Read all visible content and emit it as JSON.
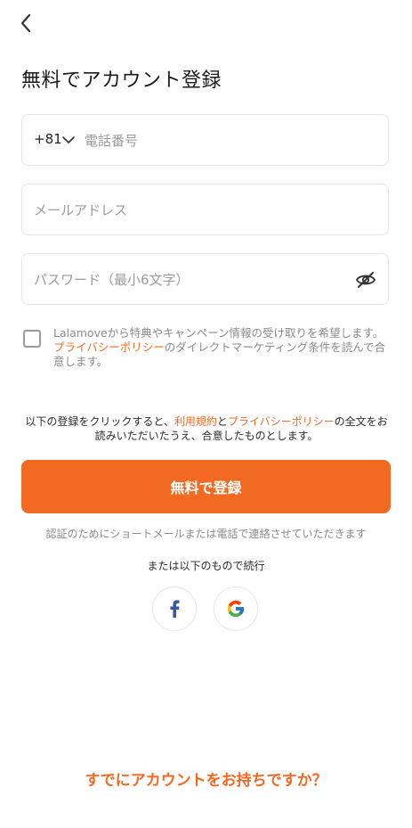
{
  "header": {
    "title": "無料でアカウント登録"
  },
  "form": {
    "phone": {
      "country_code": "+81",
      "placeholder": "電話番号"
    },
    "email": {
      "placeholder": "メールアドレス"
    },
    "password": {
      "placeholder": "パスワード（最小6文字）"
    }
  },
  "consent": {
    "text_1": "Lalamoveから特典やキャンペーン情報の受け取りを希望します。",
    "privacy_link": "プライバシーポリシー",
    "text_2": "のダイレクトマーケティング条件を読んで合意します。"
  },
  "terms": {
    "prefix": "以下の登録をクリックすると、",
    "terms_link": "利用規約",
    "and": "と",
    "privacy_link": "プライバシーポリシー",
    "suffix": "の全文をお読みいただいたうえ、合意したものとします。"
  },
  "cta": {
    "label": "無料で登録"
  },
  "sms_note": "認証のためにショートメールまたは電話で連絡させていただきます",
  "social": {
    "heading": "または以下のもので続行"
  },
  "footer": {
    "login_label": "すでにアカウントをお持ちですか？"
  },
  "colors": {
    "accent": "#f26922",
    "facebook": "#3b5998"
  },
  "icons": [
    "back-arrow-icon",
    "chevron-down-icon",
    "eye-off-icon",
    "facebook-icon",
    "google-icon"
  ]
}
